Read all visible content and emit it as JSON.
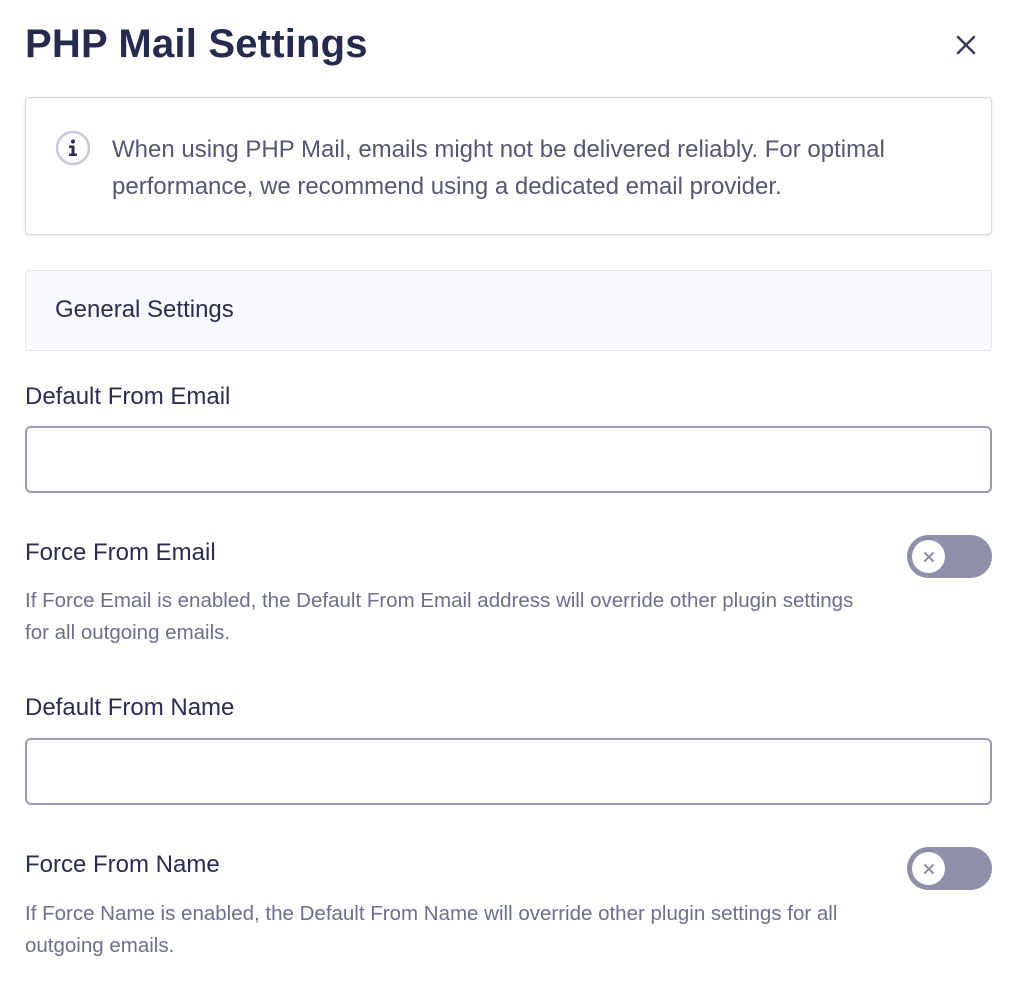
{
  "dialog": {
    "title": "PHP Mail Settings",
    "close_icon": "close-icon"
  },
  "notice": {
    "icon": "info-icon",
    "text": "When using PHP Mail, emails might not be delivered reliably. For optimal performance, we recommend using a dedicated email provider."
  },
  "section": {
    "title": "General Settings"
  },
  "from_email": {
    "label": "Default From Email",
    "value": "",
    "placeholder": ""
  },
  "force_email": {
    "label": "Force From Email",
    "enabled": false,
    "toggle_icon": "x-icon",
    "help": "If Force Email is enabled, the Default From Email address will override other plugin settings for all outgoing emails."
  },
  "from_name": {
    "label": "Default From Name",
    "value": "",
    "placeholder": ""
  },
  "force_name": {
    "label": "Force From Name",
    "enabled": false,
    "toggle_icon": "x-icon",
    "help": "If Force Name is enabled, the Default From Name will override other plugin settings for all outgoing emails."
  },
  "colors": {
    "title": "#262a4f",
    "body_text": "#55586f",
    "help_text": "#6d7088",
    "toggle_off": "#8f91ab",
    "input_border": "#9a9db4",
    "section_bg": "#f9fafd"
  }
}
